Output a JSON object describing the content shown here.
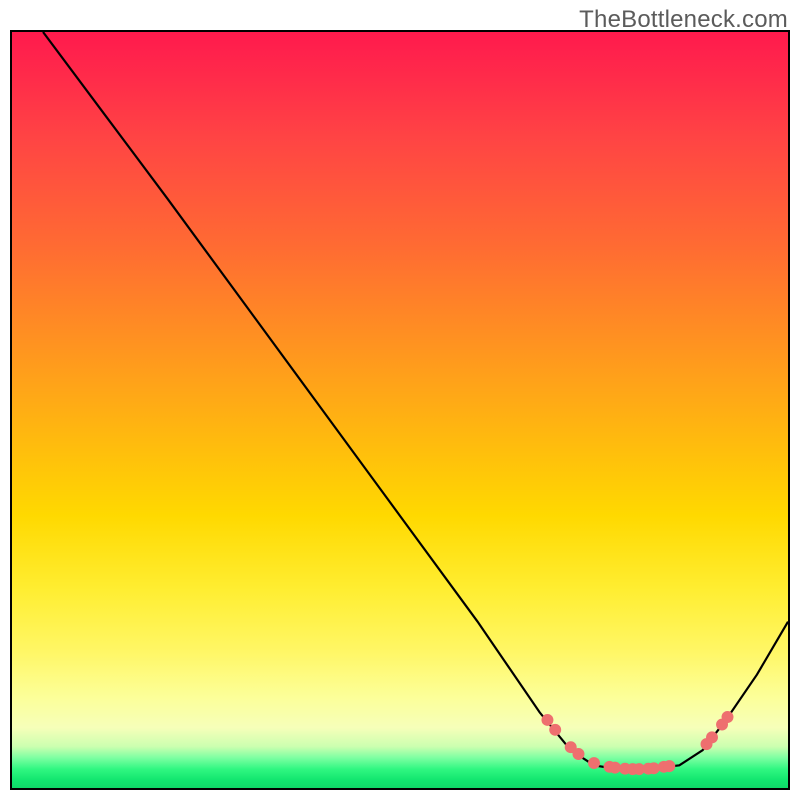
{
  "watermark": "TheBottleneck.com",
  "chart_data": {
    "type": "line",
    "title": "",
    "xlabel": "",
    "ylabel": "",
    "xlim": [
      0,
      100
    ],
    "ylim": [
      0,
      100
    ],
    "curve": [
      {
        "x": 4,
        "y": 100
      },
      {
        "x": 12,
        "y": 89
      },
      {
        "x": 20,
        "y": 78
      },
      {
        "x": 30,
        "y": 64
      },
      {
        "x": 40,
        "y": 50
      },
      {
        "x": 50,
        "y": 36
      },
      {
        "x": 60,
        "y": 22
      },
      {
        "x": 68,
        "y": 10
      },
      {
        "x": 72,
        "y": 5
      },
      {
        "x": 75,
        "y": 3
      },
      {
        "x": 78,
        "y": 2.5
      },
      {
        "x": 82,
        "y": 2.5
      },
      {
        "x": 86,
        "y": 3
      },
      {
        "x": 89,
        "y": 5
      },
      {
        "x": 92,
        "y": 9
      },
      {
        "x": 96,
        "y": 15
      },
      {
        "x": 100,
        "y": 22
      }
    ],
    "markers_left": [
      {
        "x": 69,
        "y": 9.0
      },
      {
        "x": 70,
        "y": 7.7
      },
      {
        "x": 72,
        "y": 5.4
      },
      {
        "x": 73,
        "y": 4.5
      },
      {
        "x": 75,
        "y": 3.3
      }
    ],
    "markers_bottom": [
      {
        "x": 77,
        "y": 2.8
      },
      {
        "x": 77.7,
        "y": 2.7
      },
      {
        "x": 79,
        "y": 2.55
      },
      {
        "x": 80,
        "y": 2.5
      },
      {
        "x": 80.8,
        "y": 2.5
      },
      {
        "x": 82,
        "y": 2.55
      },
      {
        "x": 82.7,
        "y": 2.6
      },
      {
        "x": 84,
        "y": 2.8
      },
      {
        "x": 84.7,
        "y": 2.9
      }
    ],
    "markers_right": [
      {
        "x": 89.5,
        "y": 5.8
      },
      {
        "x": 90.2,
        "y": 6.7
      },
      {
        "x": 91.5,
        "y": 8.4
      },
      {
        "x": 92.2,
        "y": 9.4
      }
    ],
    "gradient_colors": {
      "top": "#ff1a4d",
      "mid": "#ffd900",
      "bottom": "#0fd868"
    }
  }
}
